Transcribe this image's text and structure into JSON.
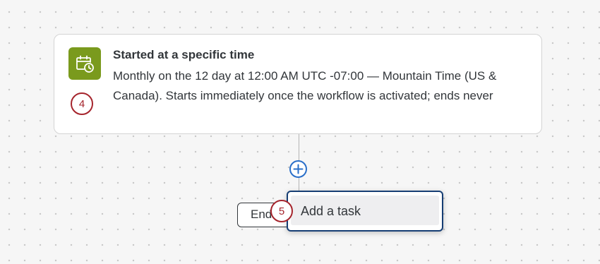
{
  "trigger": {
    "title": "Started at a specific time",
    "description": "Monthly on the 12 day at 12:00 AM UTC -07:00 — Mountain Time (US & Canada). Starts immediately once the workflow is activated; ends never",
    "icon": "calendar-clock-icon"
  },
  "steps": {
    "step_four": "4",
    "step_five": "5"
  },
  "end_node": {
    "label": "End"
  },
  "menu": {
    "items": [
      {
        "label": "Add a task"
      }
    ]
  },
  "colors": {
    "trigger_icon_bg": "#7a9a1d",
    "badge_red": "#a5242c",
    "plus_blue": "#2a6fc9",
    "menu_border": "#163e74"
  }
}
